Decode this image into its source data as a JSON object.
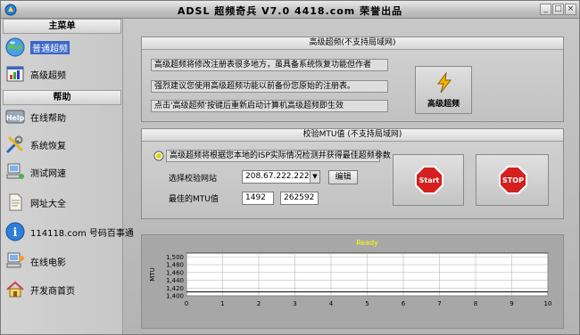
{
  "window": {
    "title": "ADSL 超频奇兵 V7.0   4418.com 荣誉出品",
    "controls": [
      "_",
      "□",
      "×"
    ]
  },
  "sidebar": {
    "main_menu_label": "主菜单",
    "help_label": "帮助",
    "items": [
      {
        "label": "普通超频",
        "icon": "globe-icon",
        "active": true
      },
      {
        "label": "高级超频",
        "icon": "chart-app-icon",
        "active": false
      },
      {
        "label": "在线帮助",
        "icon": "help-icon",
        "active": false
      },
      {
        "label": "系统恢复",
        "icon": "tools-icon",
        "active": false
      },
      {
        "label": "测试网速",
        "icon": "computer-network-icon",
        "active": false
      },
      {
        "label": "网址大全",
        "icon": "document-icon",
        "active": false
      },
      {
        "label": "114118.com 号码百事通",
        "icon": "info-icon",
        "active": false
      },
      {
        "label": "在线电影",
        "icon": "computer-movie-icon",
        "active": false
      },
      {
        "label": "开发商首页",
        "icon": "home-icon",
        "active": false
      }
    ]
  },
  "advanced_panel": {
    "title": "高级超频(不支持局域网)",
    "lines": [
      "高级超频将修改注册表很多地方，虽具备系统恢复功能但作者",
      "强烈建议您使用高级超频功能以前备份您原始的注册表。",
      "点击'高级超频'按键后重新启动计算机高级超频即生效"
    ],
    "button_label": "高级超频"
  },
  "mtu_panel": {
    "title": "校验MTU值 (不支持局域网)",
    "description": "高级超频将根据您本地的ISP实际情况检测并获得最佳超频参数",
    "site_label": "选择校验网站",
    "site_value": "208.67.222.222",
    "edit_label": "编辑",
    "best_mtu_label": "最佳的MTU值",
    "mtu_value": "1492",
    "second_value": "262592",
    "start_label": "Start",
    "stop_label": "STOP"
  },
  "chart_data": {
    "type": "line",
    "title": "Ready",
    "ylabel": "MTU",
    "xlabel": "",
    "x": [
      0,
      1,
      2,
      3,
      4,
      5,
      6,
      7,
      8,
      9,
      10
    ],
    "xlim": [
      0,
      10
    ],
    "ylim": [
      1400,
      1510
    ],
    "yticks": [
      1400,
      1420,
      1440,
      1460,
      1480,
      1500
    ],
    "ytick_labels": [
      "1,400",
      "1,420",
      "1,440",
      "1,460",
      "1,480",
      "1,500"
    ],
    "series": [
      {
        "values": [
          1410,
          1410,
          1410,
          1410,
          1410,
          1410,
          1410,
          1410,
          1410,
          1410,
          1410
        ]
      }
    ],
    "grid": true,
    "colors": {
      "plot_bg": "#ffffff",
      "title": "#ffff00",
      "panel": "#a7a7a7"
    }
  }
}
